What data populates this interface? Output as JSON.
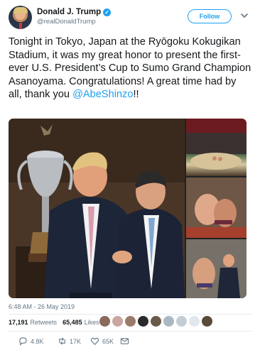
{
  "header": {
    "display_name": "Donald J. Trump",
    "handle": "@realDonaldTrump",
    "verified_icon": "check-badge-icon",
    "follow_label": "Follow",
    "menu_icon": "chevron-down-icon"
  },
  "tweet": {
    "text_before": "Tonight in Tokyo, Japan at the Ryōgoku Kokugikan Stadium, it was my great honor to present the first-ever U.S. President’s Cup to Sumo Grand Champion Asanoyama. Congratulations! A great time had by all, thank you ",
    "mention": "@AbeShinzo",
    "text_after": "!!"
  },
  "meta": {
    "timestamp": "6:48 AM - 26 May 2019"
  },
  "counts": {
    "retweets_value": "17,191",
    "retweets_label": "Retweets",
    "likes_value": "65,485",
    "likes_label": "Likes"
  },
  "actions": {
    "reply_count": "4.8K",
    "retweet_count": "17K",
    "like_count": "65K"
  },
  "colors": {
    "accent": "#1da1f2",
    "muted": "#657786"
  }
}
